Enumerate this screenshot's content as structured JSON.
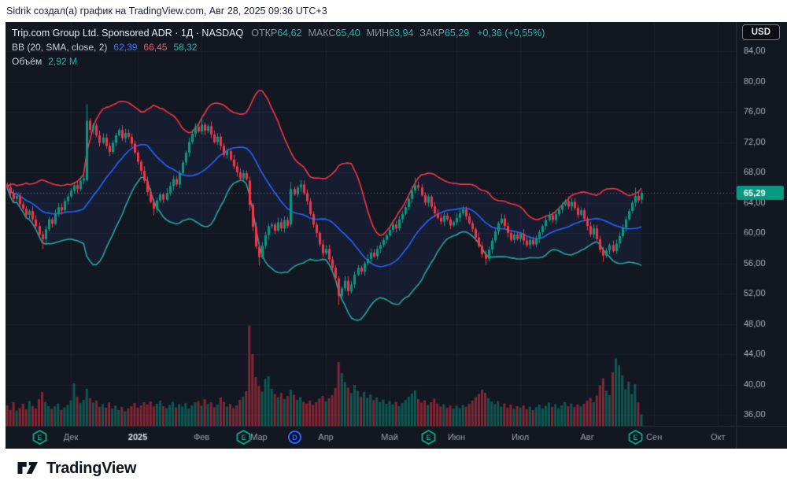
{
  "meta_bar": {
    "text": "Sidrik создал(а) график на TradingView.com, Авг 28, 2025 09:36 UTC+3"
  },
  "header": {
    "symbol_title": "Trip.com Group Ltd. Sponsored ADR · 1Д · NASDAQ",
    "open_label": "ОТКР",
    "open": "64,62",
    "high_label": "МАКС",
    "high": "65,40",
    "low_label": "МИН",
    "low": "63,94",
    "close_label": "ЗАКР",
    "close": "65,29",
    "change": "+0,36 (+0,55%)"
  },
  "indicators": {
    "bb": {
      "label": "BB (20, SMA, close, 2)",
      "basis": "62,39",
      "upper": "66,45",
      "lower": "58,32"
    },
    "volume": {
      "label": "Объём",
      "value": "2,92 М"
    }
  },
  "axes": {
    "currency_button": "USD",
    "price_ticks": [
      "84,00",
      "80,00",
      "76,00",
      "72,00",
      "68,00",
      "64,00",
      "60,00",
      "56,00",
      "52,00",
      "48,00",
      "44,00",
      "40,00",
      "36,00"
    ],
    "price_tick_values": [
      84,
      80,
      76,
      72,
      68,
      64,
      60,
      56,
      52,
      48,
      44,
      40,
      36
    ],
    "time_ticks": [
      {
        "index": 20,
        "label": "Дек",
        "major": false
      },
      {
        "index": 41,
        "label": "2025",
        "major": true
      },
      {
        "index": 61,
        "label": "Фев",
        "major": false
      },
      {
        "index": 79,
        "label": "Мар",
        "major": false
      },
      {
        "index": 100,
        "label": "Апр",
        "major": false
      },
      {
        "index": 120,
        "label": "Май",
        "major": false
      },
      {
        "index": 141,
        "label": "Июн",
        "major": false
      },
      {
        "index": 161,
        "label": "Июл",
        "major": false
      },
      {
        "index": 182,
        "label": "Авг",
        "major": false
      },
      {
        "index": 203,
        "label": "Сен",
        "major": false
      },
      {
        "index": 223,
        "label": "Окт",
        "major": false
      }
    ],
    "current_price": {
      "value": 65.29,
      "label": "65,29"
    }
  },
  "markers": [
    {
      "type": "earnings",
      "label": "E",
      "candle_index": 10
    },
    {
      "type": "earnings",
      "label": "E",
      "candle_index": 74
    },
    {
      "type": "dividend",
      "label": "D",
      "candle_index": 90
    },
    {
      "type": "earnings",
      "label": "E",
      "candle_index": 132
    },
    {
      "type": "earnings",
      "label": "E",
      "candle_index": 197
    }
  ],
  "footer": {
    "brand": "TradingView"
  },
  "colors": {
    "chart_bg": "#131722",
    "up": "#089981",
    "down": "#f23645",
    "bb_basis": "#2962ff",
    "bb_upper": "#f23645",
    "bb_lower": "#26a69a",
    "band_fill": "rgba(76,118,255,0.07)",
    "grid": "rgba(190,200,230,0.055)",
    "axis_text": "#aeb3bd",
    "month_text": "#9aa0ac",
    "major_month_text": "#dde1e8",
    "separator": "#2a2e39",
    "price_tag_bg": "#089981",
    "price_tag_text": "#ffffff"
  },
  "chart_data": {
    "type": "candlestick",
    "title": "Trip.com Group Ltd. Sponsored ADR",
    "interval_label": "1Д",
    "exchange": "NASDAQ",
    "last_ohlc": {
      "open": 64.62,
      "high": 65.4,
      "low": 63.94,
      "close": 65.29,
      "change": 0.36,
      "change_pct": 0.55
    },
    "bollinger": {
      "period": 20,
      "stdev_mult": 2,
      "basis": 62.39,
      "upper": 66.45,
      "lower": 58.32
    },
    "last_volume_m": 2.92,
    "price_axis_range": [
      36,
      84
    ],
    "grid": true,
    "total_slots": 229,
    "first_open": 66.4,
    "closes": [
      66.0,
      65.2,
      64.5,
      64.9,
      63.8,
      63.2,
      62.4,
      62.9,
      61.8,
      60.9,
      59.8,
      59.2,
      60.5,
      61.8,
      61.2,
      62.5,
      63.4,
      63.0,
      64.2,
      64.8,
      65.6,
      66.3,
      65.8,
      66.9,
      67.2,
      74.8,
      73.6,
      74.2,
      72.9,
      71.9,
      72.6,
      71.5,
      70.7,
      71.9,
      72.9,
      73.6,
      72.5,
      73.2,
      72.7,
      71.8,
      70.6,
      69.4,
      68.2,
      66.9,
      65.4,
      64.1,
      63.2,
      64.3,
      65.1,
      64.4,
      65.3,
      66.2,
      67.1,
      66.4,
      67.9,
      69.3,
      70.6,
      72.0,
      73.1,
      74.0,
      73.4,
      74.3,
      73.5,
      74.1,
      73.0,
      72.0,
      72.7,
      71.5,
      70.3,
      70.8,
      69.7,
      68.8,
      68.0,
      67.2,
      67.9,
      67.1,
      63.7,
      60.8,
      58.2,
      56.8,
      58.3,
      59.7,
      60.9,
      61.1,
      60.3,
      61.4,
      60.6,
      61.7,
      60.9,
      65.8,
      65.1,
      66.0,
      66.4,
      65.3,
      64.2,
      62.5,
      61.1,
      60.0,
      58.5,
      57.3,
      57.9,
      56.5,
      55.4,
      54.0,
      51.7,
      52.7,
      53.7,
      52.3,
      53.2,
      54.5,
      55.4,
      54.9,
      56.0,
      56.6,
      57.4,
      56.9,
      57.9,
      58.4,
      59.1,
      59.7,
      60.4,
      61.1,
      60.6,
      61.8,
      62.5,
      63.4,
      64.5,
      65.6,
      66.3,
      66.0,
      65.0,
      64.0,
      64.8,
      63.5,
      62.6,
      62.0,
      61.5,
      62.3,
      61.8,
      61.0,
      61.4,
      62.0,
      62.6,
      63.1,
      62.2,
      61.3,
      60.5,
      59.4,
      58.3,
      57.2,
      56.6,
      57.8,
      59.0,
      60.2,
      61.3,
      61.9,
      60.9,
      60.0,
      59.1,
      59.8,
      59.2,
      59.9,
      59.0,
      58.4,
      59.1,
      58.5,
      59.3,
      60.1,
      60.9,
      61.7,
      62.3,
      61.7,
      62.5,
      63.1,
      63.7,
      64.2,
      63.5,
      64.1,
      63.3,
      62.4,
      63.0,
      61.9,
      60.9,
      59.8,
      60.6,
      59.2,
      57.8,
      57.0,
      57.7,
      58.4,
      57.6,
      58.6,
      59.6,
      60.7,
      61.8,
      62.9,
      64.0,
      64.9,
      64.3,
      65.29
    ],
    "volumes_m": [
      5.2,
      4.1,
      6.0,
      3.9,
      4.5,
      5.6,
      4.2,
      6.3,
      5.0,
      4.4,
      6.8,
      8.6,
      6.1,
      5.0,
      4.3,
      4.9,
      5.7,
      4.1,
      4.7,
      5.3,
      6.5,
      10.8,
      7.4,
      5.8,
      6.6,
      9.4,
      7.0,
      5.9,
      6.4,
      4.8,
      5.5,
      4.6,
      5.9,
      4.4,
      5.1,
      4.0,
      4.8,
      3.7,
      4.4,
      5.0,
      5.8,
      4.6,
      5.2,
      6.0,
      5.4,
      6.2,
      4.9,
      5.6,
      6.4,
      5.0,
      4.5,
      5.3,
      6.1,
      4.7,
      5.5,
      4.9,
      5.8,
      4.4,
      5.2,
      5.9,
      6.3,
      5.1,
      6.8,
      5.5,
      6.0,
      4.7,
      5.4,
      7.2,
      6.1,
      4.9,
      5.6,
      4.5,
      5.2,
      6.6,
      7.4,
      8.8,
      25.5,
      18.2,
      12.4,
      10.1,
      8.7,
      11.9,
      12.6,
      9.4,
      8.1,
      7.2,
      8.4,
      6.8,
      7.5,
      9.2,
      7.9,
      6.6,
      7.3,
      6.1,
      5.7,
      6.4,
      5.3,
      6.0,
      6.9,
      7.6,
      6.2,
      7.0,
      7.8,
      9.6,
      16.2,
      13.4,
      11.1,
      9.7,
      8.3,
      10.4,
      8.9,
      7.4,
      8.6,
      7.1,
      7.9,
      6.5,
      7.2,
      6.0,
      6.7,
      5.6,
      6.3,
      5.4,
      6.1,
      5.0,
      5.8,
      6.6,
      7.4,
      8.2,
      9.0,
      6.8,
      5.9,
      6.5,
      5.3,
      6.0,
      6.9,
      5.7,
      4.9,
      5.5,
      4.6,
      5.2,
      4.4,
      5.1,
      4.5,
      5.3,
      4.8,
      5.6,
      6.4,
      7.3,
      8.1,
      9.2,
      8.4,
      7.0,
      6.2,
      5.5,
      6.3,
      4.9,
      5.7,
      4.6,
      5.4,
      4.3,
      5.0,
      4.6,
      5.2,
      4.2,
      4.9,
      4.0,
      4.7,
      5.4,
      4.4,
      5.1,
      5.9,
      4.8,
      5.5,
      4.5,
      5.2,
      6.0,
      5.0,
      5.7,
      4.7,
      5.4,
      4.9,
      5.6,
      6.4,
      7.1,
      6.0,
      7.7,
      10.3,
      12.1,
      8.9,
      7.8,
      13.6,
      17.1,
      15.4,
      12.8,
      9.3,
      11.2,
      8.1,
      10.6,
      5.9,
      2.92
    ],
    "special_candles": {
      "11": {
        "l": 57.9
      },
      "25": {
        "o": 67.0,
        "h": 77.0,
        "l": 66.8
      },
      "46": {
        "l": 62.3
      },
      "61": {
        "h": 75.2
      },
      "76": {
        "o": 66.9,
        "l": 62.9
      },
      "79": {
        "l": 55.7
      },
      "89": {
        "o": 61.1,
        "h": 66.7,
        "l": 60.8
      },
      "104": {
        "l": 50.5
      },
      "128": {
        "h": 67.3
      },
      "150": {
        "l": 55.8
      },
      "187": {
        "l": 56.2
      },
      "197": {
        "h": 66.0
      },
      "199": {
        "o": 64.4,
        "h": 65.6,
        "l": 63.9
      }
    }
  }
}
